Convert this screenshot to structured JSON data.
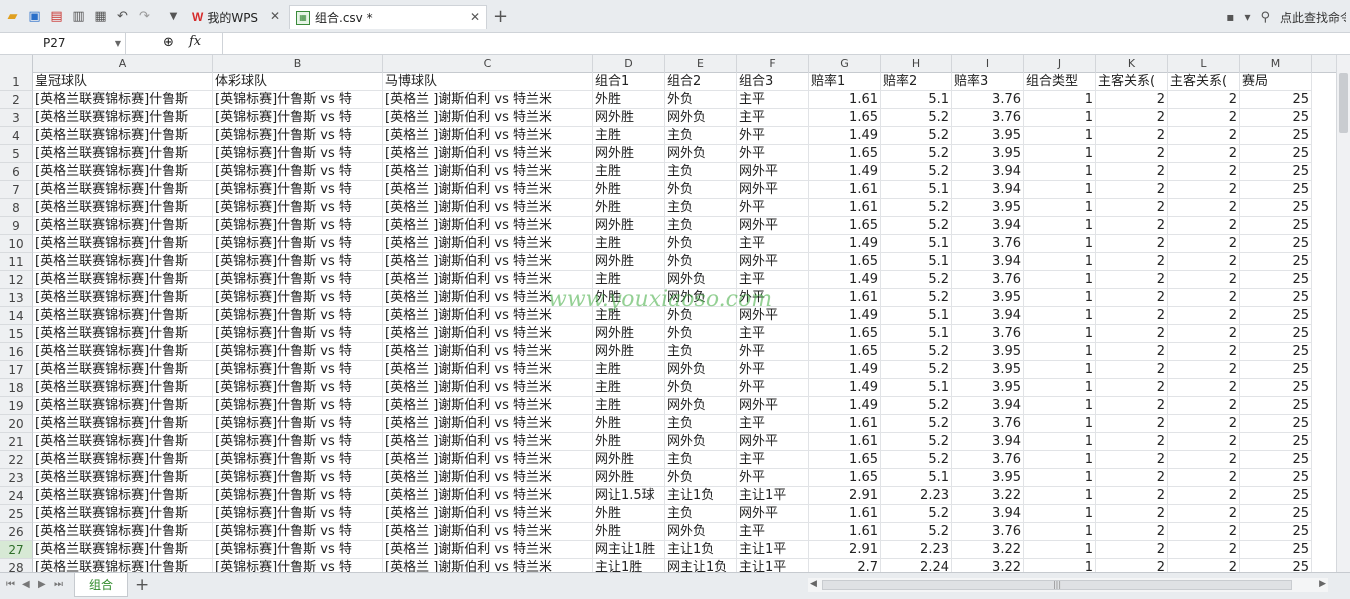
{
  "tabs": [
    {
      "label": "我的WPS"
    },
    {
      "label": "组合.csv *"
    }
  ],
  "toolbar": {
    "search_hint": "点此查找命令"
  },
  "formula_bar": {
    "name_box": "P27",
    "fx": "fx",
    "formula": ""
  },
  "columns": [
    "A",
    "B",
    "C",
    "D",
    "E",
    "F",
    "G",
    "H",
    "I",
    "J",
    "K",
    "L",
    "M"
  ],
  "header_row": {
    "row_num": "1",
    "cells": [
      "皇冠球队",
      "体彩球队",
      "马博球队",
      "组合1",
      "组合2",
      "组合3",
      "赔率1",
      "赔率2",
      "赔率3",
      "组合类型",
      "主客关系(",
      "主客关系(",
      "赛局"
    ]
  },
  "row_text": {
    "a": "[英格兰联赛锦标赛]什鲁斯",
    "b": "[英锦标赛]什鲁斯 vs 特",
    "c": "[英格兰 ]谢斯伯利 vs 特兰米"
  },
  "rows": [
    {
      "n": "2",
      "d": "外胜",
      "e": "外负",
      "f": "主平",
      "g": "1.61",
      "h": "5.1",
      "i": "3.76",
      "j": "1",
      "k": "2",
      "l": "2",
      "m": "25"
    },
    {
      "n": "3",
      "d": "网外胜",
      "e": "网外负",
      "f": "主平",
      "g": "1.65",
      "h": "5.2",
      "i": "3.76",
      "j": "1",
      "k": "2",
      "l": "2",
      "m": "25"
    },
    {
      "n": "4",
      "d": "主胜",
      "e": "主负",
      "f": "外平",
      "g": "1.49",
      "h": "5.2",
      "i": "3.95",
      "j": "1",
      "k": "2",
      "l": "2",
      "m": "25"
    },
    {
      "n": "5",
      "d": "网外胜",
      "e": "网外负",
      "f": "外平",
      "g": "1.65",
      "h": "5.2",
      "i": "3.95",
      "j": "1",
      "k": "2",
      "l": "2",
      "m": "25"
    },
    {
      "n": "6",
      "d": "主胜",
      "e": "主负",
      "f": "网外平",
      "g": "1.49",
      "h": "5.2",
      "i": "3.94",
      "j": "1",
      "k": "2",
      "l": "2",
      "m": "25"
    },
    {
      "n": "7",
      "d": "外胜",
      "e": "外负",
      "f": "网外平",
      "g": "1.61",
      "h": "5.1",
      "i": "3.94",
      "j": "1",
      "k": "2",
      "l": "2",
      "m": "25"
    },
    {
      "n": "8",
      "d": "外胜",
      "e": "主负",
      "f": "外平",
      "g": "1.61",
      "h": "5.2",
      "i": "3.95",
      "j": "1",
      "k": "2",
      "l": "2",
      "m": "25"
    },
    {
      "n": "9",
      "d": "网外胜",
      "e": "主负",
      "f": "网外平",
      "g": "1.65",
      "h": "5.2",
      "i": "3.94",
      "j": "1",
      "k": "2",
      "l": "2",
      "m": "25"
    },
    {
      "n": "10",
      "d": "主胜",
      "e": "外负",
      "f": "主平",
      "g": "1.49",
      "h": "5.1",
      "i": "3.76",
      "j": "1",
      "k": "2",
      "l": "2",
      "m": "25"
    },
    {
      "n": "11",
      "d": "网外胜",
      "e": "外负",
      "f": "网外平",
      "g": "1.65",
      "h": "5.1",
      "i": "3.94",
      "j": "1",
      "k": "2",
      "l": "2",
      "m": "25"
    },
    {
      "n": "12",
      "d": "主胜",
      "e": "网外负",
      "f": "主平",
      "g": "1.49",
      "h": "5.2",
      "i": "3.76",
      "j": "1",
      "k": "2",
      "l": "2",
      "m": "25"
    },
    {
      "n": "13",
      "d": "外胜",
      "e": "网外负",
      "f": "外平",
      "g": "1.61",
      "h": "5.2",
      "i": "3.95",
      "j": "1",
      "k": "2",
      "l": "2",
      "m": "25"
    },
    {
      "n": "14",
      "d": "主胜",
      "e": "外负",
      "f": "网外平",
      "g": "1.49",
      "h": "5.1",
      "i": "3.94",
      "j": "1",
      "k": "2",
      "l": "2",
      "m": "25"
    },
    {
      "n": "15",
      "d": "网外胜",
      "e": "外负",
      "f": "主平",
      "g": "1.65",
      "h": "5.1",
      "i": "3.76",
      "j": "1",
      "k": "2",
      "l": "2",
      "m": "25"
    },
    {
      "n": "16",
      "d": "网外胜",
      "e": "主负",
      "f": "外平",
      "g": "1.65",
      "h": "5.2",
      "i": "3.95",
      "j": "1",
      "k": "2",
      "l": "2",
      "m": "25"
    },
    {
      "n": "17",
      "d": "主胜",
      "e": "网外负",
      "f": "外平",
      "g": "1.49",
      "h": "5.2",
      "i": "3.95",
      "j": "1",
      "k": "2",
      "l": "2",
      "m": "25"
    },
    {
      "n": "18",
      "d": "主胜",
      "e": "外负",
      "f": "外平",
      "g": "1.49",
      "h": "5.1",
      "i": "3.95",
      "j": "1",
      "k": "2",
      "l": "2",
      "m": "25"
    },
    {
      "n": "19",
      "d": "主胜",
      "e": "网外负",
      "f": "网外平",
      "g": "1.49",
      "h": "5.2",
      "i": "3.94",
      "j": "1",
      "k": "2",
      "l": "2",
      "m": "25"
    },
    {
      "n": "20",
      "d": "外胜",
      "e": "主负",
      "f": "主平",
      "g": "1.61",
      "h": "5.2",
      "i": "3.76",
      "j": "1",
      "k": "2",
      "l": "2",
      "m": "25"
    },
    {
      "n": "21",
      "d": "外胜",
      "e": "网外负",
      "f": "网外平",
      "g": "1.61",
      "h": "5.2",
      "i": "3.94",
      "j": "1",
      "k": "2",
      "l": "2",
      "m": "25"
    },
    {
      "n": "22",
      "d": "网外胜",
      "e": "主负",
      "f": "主平",
      "g": "1.65",
      "h": "5.2",
      "i": "3.76",
      "j": "1",
      "k": "2",
      "l": "2",
      "m": "25"
    },
    {
      "n": "23",
      "d": "网外胜",
      "e": "外负",
      "f": "外平",
      "g": "1.65",
      "h": "5.1",
      "i": "3.95",
      "j": "1",
      "k": "2",
      "l": "2",
      "m": "25"
    },
    {
      "n": "24",
      "d": "网让1.5球",
      "e": "主让1负",
      "f": "主让1平",
      "g": "2.91",
      "h": "2.23",
      "i": "3.22",
      "j": "1",
      "k": "2",
      "l": "2",
      "m": "25"
    },
    {
      "n": "25",
      "d": "外胜",
      "e": "主负",
      "f": "网外平",
      "g": "1.61",
      "h": "5.2",
      "i": "3.94",
      "j": "1",
      "k": "2",
      "l": "2",
      "m": "25"
    },
    {
      "n": "26",
      "d": "外胜",
      "e": "网外负",
      "f": "主平",
      "g": "1.61",
      "h": "5.2",
      "i": "3.76",
      "j": "1",
      "k": "2",
      "l": "2",
      "m": "25"
    },
    {
      "n": "27",
      "d": "网主让1胜",
      "e": "主让1负",
      "f": "主让1平",
      "g": "2.91",
      "h": "2.23",
      "i": "3.22",
      "j": "1",
      "k": "2",
      "l": "2",
      "m": "25"
    },
    {
      "n": "28",
      "d": "主让1胜",
      "e": "网主让1负",
      "f": "主让1平",
      "g": "2.7",
      "h": "2.24",
      "i": "3.22",
      "j": "1",
      "k": "2",
      "l": "2",
      "m": "25"
    }
  ],
  "active_row": "27",
  "watermark": "www.youxiaoso.com",
  "sheet_tab": "组合",
  "colors": {
    "accent": "#2f8a2a",
    "wps_red": "#d62b2b"
  }
}
